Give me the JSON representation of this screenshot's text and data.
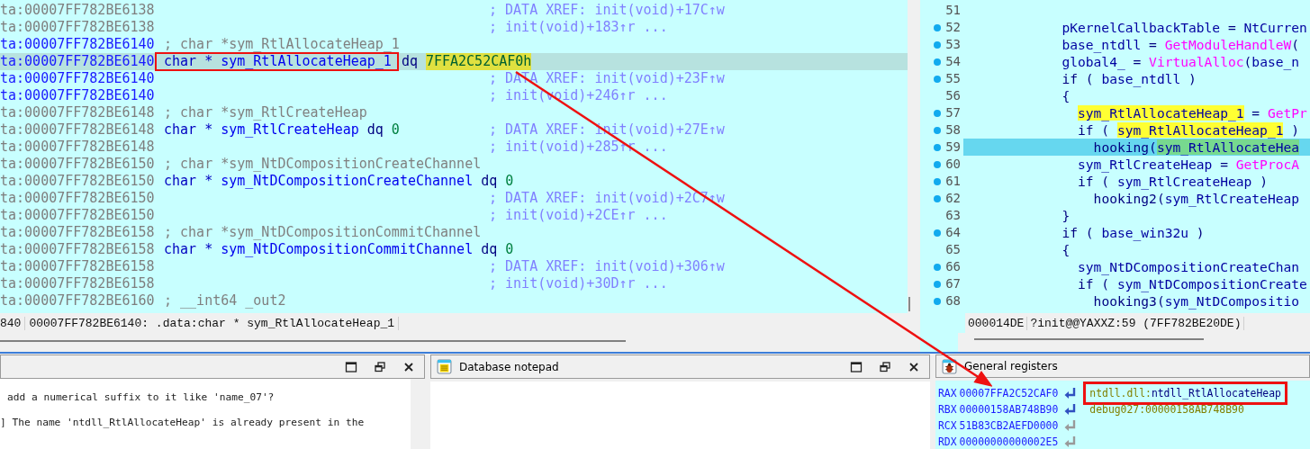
{
  "disassembly": {
    "lines": [
      {
        "address": "ta:00007FF782BE6138",
        "current": false,
        "selected": false,
        "xref": "; DATA XREF: init(void)+17C↑w"
      },
      {
        "address": "ta:00007FF782BE6138",
        "current": false,
        "selected": false,
        "xref": "; init(void)+183↑r ..."
      },
      {
        "address": "ta:00007FF782BE6140",
        "current": true,
        "selected": false,
        "comment": "; char *sym_RtlAllocateHeap_1"
      },
      {
        "address": "ta:00007FF782BE6140",
        "current": true,
        "selected": true,
        "code": {
          "decl_type": "char *",
          "name": "sym_RtlAllocateHeap_1",
          "directive": "dq",
          "value": "7FFA2C52CAF0h",
          "value_highlighted": true,
          "boxed": true
        }
      },
      {
        "address": "ta:00007FF782BE6140",
        "current": true,
        "selected": false,
        "xref": "; DATA XREF: init(void)+23F↑w"
      },
      {
        "address": "ta:00007FF782BE6140",
        "current": true,
        "selected": false,
        "xref": "; init(void)+246↑r ..."
      },
      {
        "address": "ta:00007FF782BE6148",
        "current": false,
        "selected": false,
        "comment": "; char *sym_RtlCreateHeap"
      },
      {
        "address": "ta:00007FF782BE6148",
        "current": false,
        "selected": false,
        "code": {
          "decl_type": "char *",
          "name": "sym_RtlCreateHeap",
          "directive": "dq",
          "value": "0",
          "value_highlighted": false,
          "boxed": false
        },
        "xref": "; DATA XREF: init(void)+27E↑w"
      },
      {
        "address": "ta:00007FF782BE6148",
        "current": false,
        "selected": false,
        "xref": "; init(void)+285↑r ..."
      },
      {
        "address": "ta:00007FF782BE6150",
        "current": false,
        "selected": false,
        "comment": "; char *sym_NtDCompositionCreateChannel"
      },
      {
        "address": "ta:00007FF782BE6150",
        "current": false,
        "selected": false,
        "code": {
          "decl_type": "char *",
          "name": "sym_NtDCompositionCreateChannel",
          "directive": "dq",
          "value": "0",
          "value_highlighted": false,
          "boxed": false
        }
      },
      {
        "address": "ta:00007FF782BE6150",
        "current": false,
        "selected": false,
        "xref": "; DATA XREF: init(void)+2C7↑w"
      },
      {
        "address": "ta:00007FF782BE6150",
        "current": false,
        "selected": false,
        "xref": "; init(void)+2CE↑r ..."
      },
      {
        "address": "ta:00007FF782BE6158",
        "current": false,
        "selected": false,
        "comment": "; char *sym_NtDCompositionCommitChannel"
      },
      {
        "address": "ta:00007FF782BE6158",
        "current": false,
        "selected": false,
        "code": {
          "decl_type": "char *",
          "name": "sym_NtDCompositionCommitChannel",
          "directive": "dq",
          "value": "0",
          "value_highlighted": false,
          "boxed": false
        }
      },
      {
        "address": "ta:00007FF782BE6158",
        "current": false,
        "selected": false,
        "xref": "; DATA XREF: init(void)+306↑w"
      },
      {
        "address": "ta:00007FF782BE6158",
        "current": false,
        "selected": false,
        "xref": "; init(void)+30D↑r ..."
      },
      {
        "address": "ta:00007FF782BE6160",
        "current": false,
        "selected": false,
        "comment": "; __int64 _out2"
      }
    ],
    "status_bar": {
      "prefix": "840",
      "location": "00007FF782BE6140: .data:char * sym_RtlAllocateHeap_1"
    }
  },
  "pseudocode": {
    "lines": [
      {
        "number": "51",
        "has_code": false,
        "selected": false
      },
      {
        "number": "52",
        "has_code": true,
        "selected": false,
        "tokens": [
          {
            "text": "            pKernelCallbackTable",
            "kind": "ident"
          },
          {
            "text": " = ",
            "kind": "plain"
          },
          {
            "text": "NtCurren",
            "kind": "ident"
          }
        ]
      },
      {
        "number": "53",
        "has_code": true,
        "selected": false,
        "tokens": [
          {
            "text": "            base_ntdll",
            "kind": "ident"
          },
          {
            "text": " = ",
            "kind": "plain"
          },
          {
            "text": "GetModuleHandleW",
            "kind": "func"
          },
          {
            "text": "(",
            "kind": "plain"
          }
        ]
      },
      {
        "number": "54",
        "has_code": true,
        "selected": false,
        "tokens": [
          {
            "text": "            global4_",
            "kind": "ident"
          },
          {
            "text": " = ",
            "kind": "plain"
          },
          {
            "text": "VirtualAlloc",
            "kind": "func"
          },
          {
            "text": "(",
            "kind": "plain"
          },
          {
            "text": "base_n",
            "kind": "ident"
          }
        ]
      },
      {
        "number": "55",
        "has_code": true,
        "selected": false,
        "tokens": [
          {
            "text": "            if ( ",
            "kind": "plain"
          },
          {
            "text": "base_ntdll",
            "kind": "ident"
          },
          {
            "text": " )",
            "kind": "plain"
          }
        ]
      },
      {
        "number": "56",
        "has_code": false,
        "selected": false,
        "tokens": [
          {
            "text": "            {",
            "kind": "plain"
          }
        ]
      },
      {
        "number": "57",
        "has_code": true,
        "selected": false,
        "tokens": [
          {
            "text": "              sym_RtlAllocateHeap_1",
            "kind": "highlight"
          },
          {
            "text": " = ",
            "kind": "plain"
          },
          {
            "text": "GetPr",
            "kind": "func"
          }
        ]
      },
      {
        "number": "58",
        "has_code": true,
        "selected": false,
        "tokens": [
          {
            "text": "              if ( ",
            "kind": "plain"
          },
          {
            "text": "sym_RtlAllocateHeap_1",
            "kind": "highlight"
          },
          {
            "text": " )",
            "kind": "plain"
          }
        ]
      },
      {
        "number": "59",
        "has_code": true,
        "selected": true,
        "tokens": [
          {
            "text": "                hooking(",
            "kind": "plain"
          },
          {
            "text": "sym_RtlAllocateHea",
            "kind": "cursor"
          }
        ]
      },
      {
        "number": "60",
        "has_code": true,
        "selected": false,
        "tokens": [
          {
            "text": "              sym_RtlCreateHeap",
            "kind": "ident"
          },
          {
            "text": " = ",
            "kind": "plain"
          },
          {
            "text": "GetProcA",
            "kind": "func"
          }
        ]
      },
      {
        "number": "61",
        "has_code": true,
        "selected": false,
        "tokens": [
          {
            "text": "              if ( ",
            "kind": "plain"
          },
          {
            "text": "sym_RtlCreateHeap",
            "kind": "ident"
          },
          {
            "text": " )",
            "kind": "plain"
          }
        ]
      },
      {
        "number": "62",
        "has_code": true,
        "selected": false,
        "tokens": [
          {
            "text": "                hooking2(",
            "kind": "plain"
          },
          {
            "text": "sym_RtlCreateHeap",
            "kind": "ident"
          }
        ]
      },
      {
        "number": "63",
        "has_code": false,
        "selected": false,
        "tokens": [
          {
            "text": "            }",
            "kind": "plain"
          }
        ]
      },
      {
        "number": "64",
        "has_code": true,
        "selected": false,
        "tokens": [
          {
            "text": "            if ( ",
            "kind": "plain"
          },
          {
            "text": "base_win32u",
            "kind": "ident"
          },
          {
            "text": " )",
            "kind": "plain"
          }
        ]
      },
      {
        "number": "65",
        "has_code": false,
        "selected": false,
        "tokens": [
          {
            "text": "            {",
            "kind": "plain"
          }
        ]
      },
      {
        "number": "66",
        "has_code": true,
        "selected": false,
        "tokens": [
          {
            "text": "              sym_NtDCompositionCreateChan",
            "kind": "ident"
          }
        ]
      },
      {
        "number": "67",
        "has_code": true,
        "selected": false,
        "tokens": [
          {
            "text": "              if ( ",
            "kind": "plain"
          },
          {
            "text": "sym_NtDCompositionCreate",
            "kind": "ident"
          }
        ]
      },
      {
        "number": "68",
        "has_code": true,
        "selected": false,
        "tokens": [
          {
            "text": "                hooking3(",
            "kind": "plain"
          },
          {
            "text": "sym_NtDCompositio",
            "kind": "ident"
          }
        ]
      }
    ],
    "status_bar": {
      "offset": "000014DE",
      "location": "?init@@YAXXZ:59 (7FF782BE20DE)"
    }
  },
  "output": {
    "lines": [
      "add a numerical suffix to it like 'name_07'?",
      "] The name 'ntdll_RtlAllocateHeap' is already present in the"
    ]
  },
  "notepad": {
    "title": "Database notepad"
  },
  "registers": {
    "title": "General registers",
    "rows": [
      {
        "name": "RAX",
        "value": "00007FFA2C52CAF0",
        "pointer": true,
        "target_segment": "ntdll.dll:",
        "target_symbol": "ntdll_RtlAllocateHeap",
        "boxed": true
      },
      {
        "name": "RBX",
        "value": "00000158AB748B90",
        "pointer": true,
        "target_segment": "debug027:00000158AB748B90",
        "boxed": false
      },
      {
        "name": "RCX",
        "value": "51B83CB2AEFD0000",
        "pointer": false,
        "boxed": false
      },
      {
        "name": "RDX",
        "value": "00000000000002E5",
        "pointer": false,
        "boxed": false
      }
    ]
  }
}
